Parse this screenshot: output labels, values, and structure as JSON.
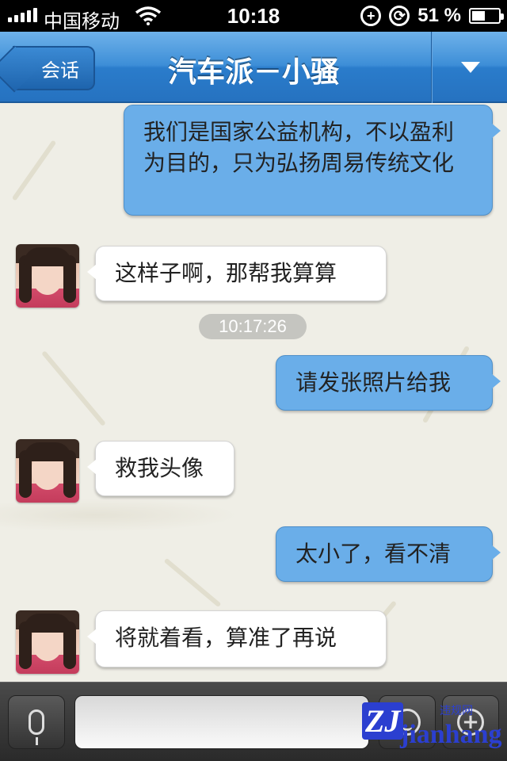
{
  "status_bar": {
    "carrier": "中国移动",
    "time": "10:18",
    "battery": "51 %",
    "battery_level": 0.51
  },
  "nav": {
    "back_label": "会话",
    "title": "汽车派－小骚"
  },
  "messages": [
    {
      "side": "out",
      "text": "我们是国家公益机构，不以盈利为目的，只为弘扬周易传统文化"
    },
    {
      "side": "in",
      "text": "这样子啊，那帮我算算"
    },
    {
      "timestamp": "10:17:26"
    },
    {
      "side": "out",
      "text": "请发张照片给我"
    },
    {
      "side": "in",
      "text": "救我头像"
    },
    {
      "side": "out",
      "text": "太小了，看不清"
    },
    {
      "side": "in",
      "text": "将就着看，算准了再说"
    }
  ],
  "input_bar": {
    "value": "",
    "placeholder": ""
  },
  "watermark": {
    "logo": "ZJ",
    "brand": "jianhang",
    "small": "违规网"
  },
  "colors": {
    "nav_blue": "#3d8ed7",
    "outgoing_bubble": "#6aaee9",
    "incoming_bubble": "#ffffff",
    "chat_background": "#efeee6"
  }
}
